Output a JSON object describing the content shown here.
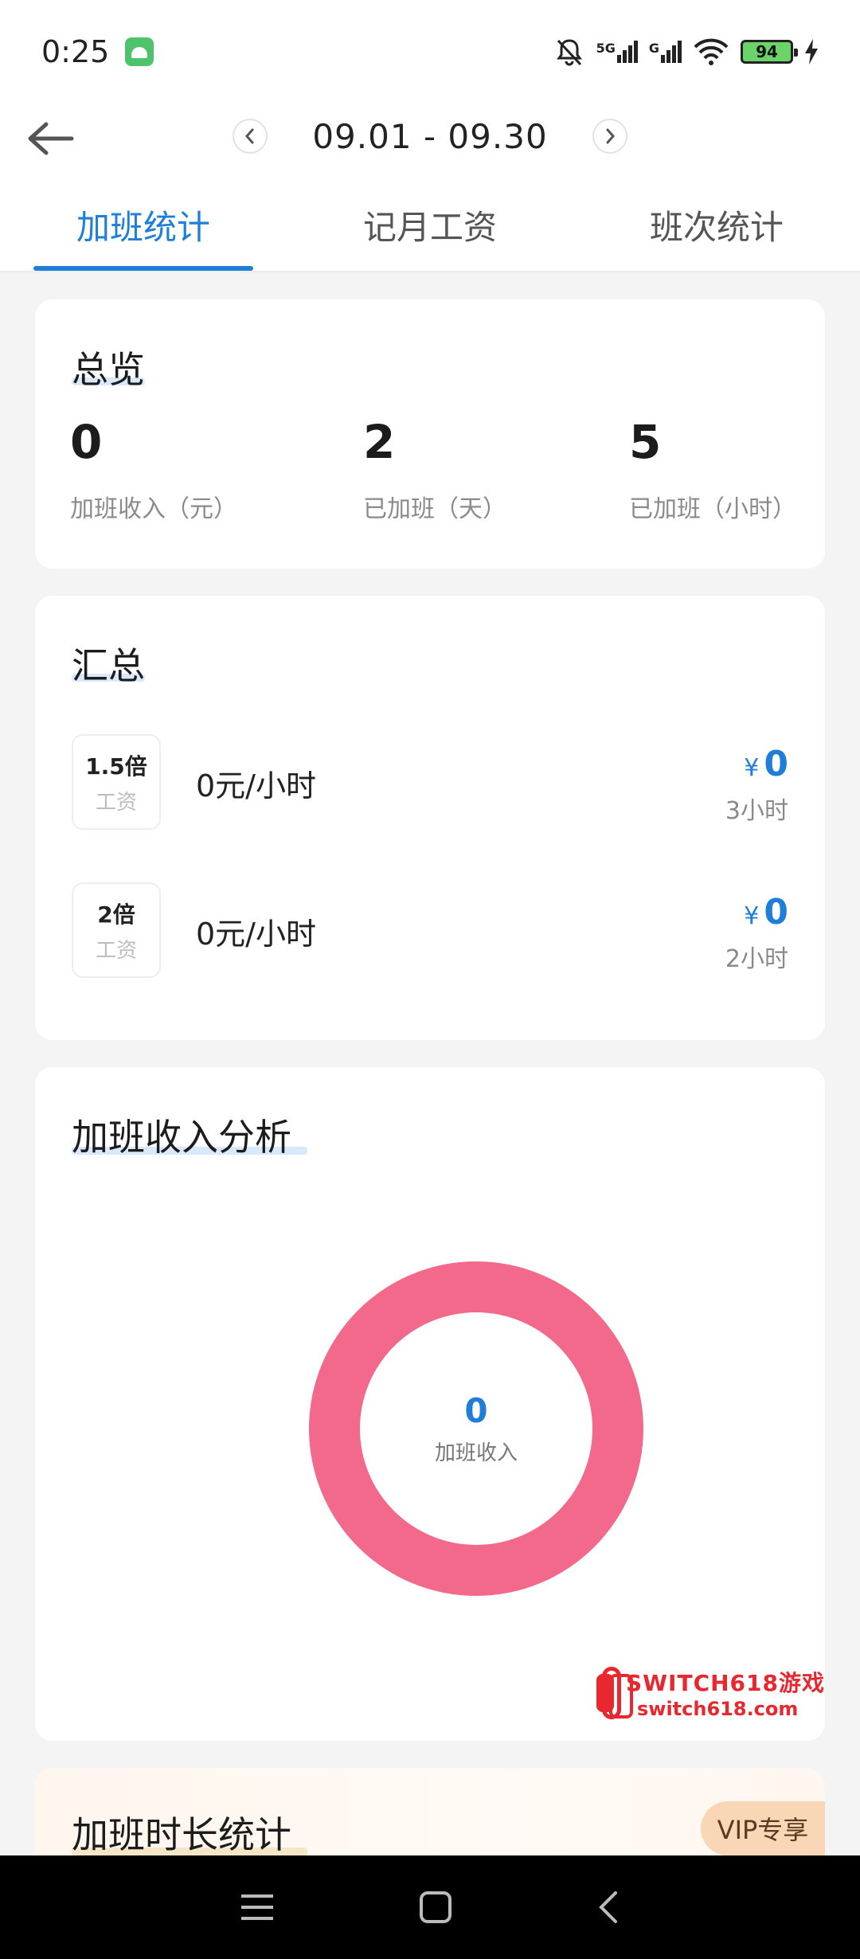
{
  "status_bar": {
    "time": "0:25",
    "battery": "94",
    "signal_label_1": "5G",
    "signal_label_2": "G"
  },
  "header": {
    "date_range": "09.01 - 09.30",
    "tabs": [
      {
        "label": "加班统计",
        "active": true
      },
      {
        "label": "记月工资",
        "active": false
      },
      {
        "label": "班次统计",
        "active": false
      }
    ]
  },
  "overview": {
    "title": "总览",
    "stats": [
      {
        "value": "0",
        "label": "加班收入（元）"
      },
      {
        "value": "2",
        "label": "已加班（天）"
      },
      {
        "value": "5",
        "label": "已加班（小时）"
      }
    ]
  },
  "summary": {
    "title": "汇总",
    "rows": [
      {
        "multiplier": "1.5倍",
        "sub": "工资",
        "rate": "0元/小时",
        "currency": "¥",
        "amount": "0",
        "hours": "3小时"
      },
      {
        "multiplier": "2倍",
        "sub": "工资",
        "rate": "0元/小时",
        "currency": "¥",
        "amount": "0",
        "hours": "2小时"
      }
    ]
  },
  "analysis": {
    "title": "加班收入分析",
    "donut_value": "0",
    "donut_label": "加班收入",
    "donut_color": "#f2698b"
  },
  "watermark": {
    "line1": "SWITCH618游戏",
    "line2": "switch618.com"
  },
  "duration": {
    "title": "加班时长统计",
    "vip_badge": "VIP专享"
  },
  "colors": {
    "accent": "#1f7fd8",
    "donut": "#f2698b",
    "watermark": "#e8272f"
  }
}
